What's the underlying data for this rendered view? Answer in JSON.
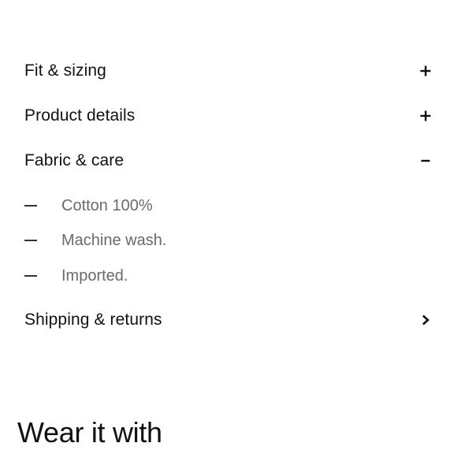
{
  "accordion": {
    "items": [
      {
        "label": "Fit & sizing",
        "icon": "plus-icon",
        "state": "collapsed"
      },
      {
        "label": "Product details",
        "icon": "plus-icon",
        "state": "collapsed"
      },
      {
        "label": "Fabric & care",
        "icon": "minus-icon",
        "state": "expanded"
      },
      {
        "label": "Shipping & returns",
        "icon": "chevron-right-icon",
        "state": "link"
      }
    ],
    "fabric_care_details": [
      "Cotton 100%",
      "Machine wash.",
      "Imported."
    ]
  },
  "section": {
    "title": "Wear it with"
  }
}
